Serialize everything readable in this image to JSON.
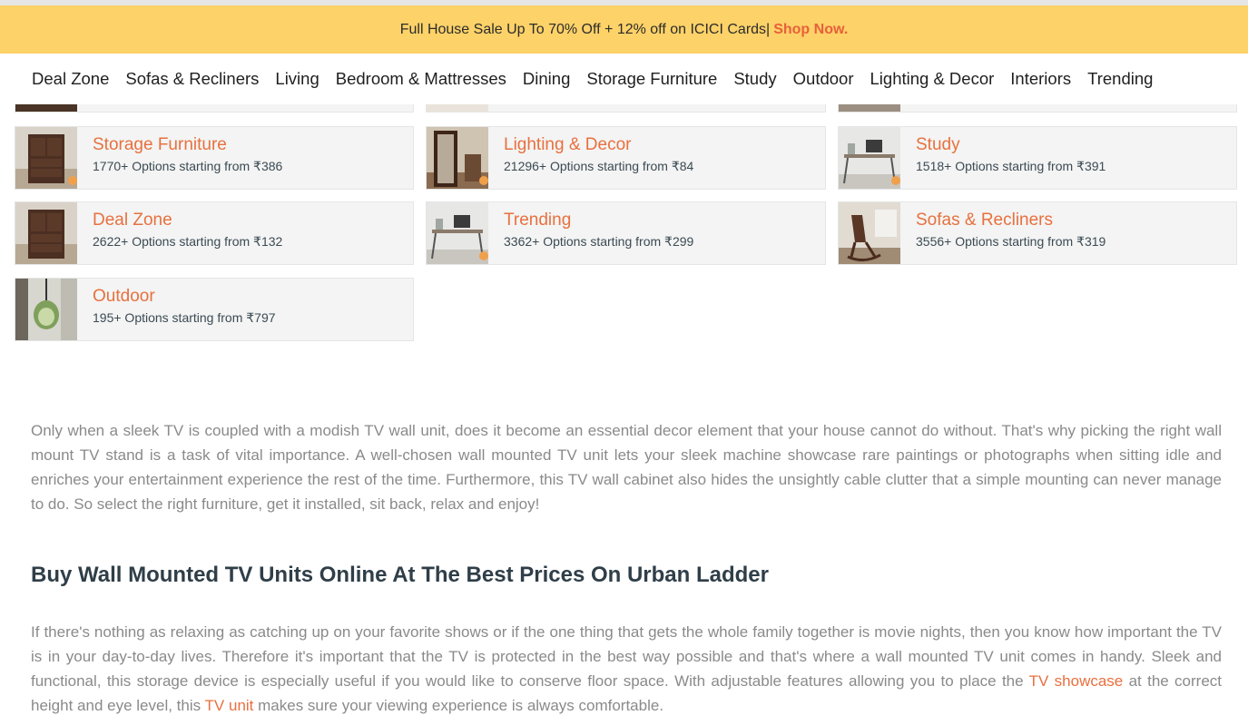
{
  "banner": {
    "text": "Full House Sale Up To 70% Off + 12% off on ICICI Cards|",
    "cta": "Shop Now."
  },
  "nav": {
    "items": [
      "Deal Zone",
      "Sofas & Recliners",
      "Living",
      "Bedroom & Mattresses",
      "Dining",
      "Storage Furniture",
      "Study",
      "Outdoor",
      "Lighting & Decor",
      "Interiors",
      "Trending"
    ]
  },
  "categories": [
    {
      "title": "Storage Furniture",
      "count": "1770+ Options starting from ",
      "price": "₹386",
      "thumb": "wooden-cabinet-icon"
    },
    {
      "title": "Lighting & Decor",
      "count": "21296+ Options starting from ",
      "price": "₹84",
      "thumb": "floor-mirror-icon"
    },
    {
      "title": "Study",
      "count": "1518+ Options starting from ",
      "price": "₹391",
      "thumb": "study-desk-icon"
    },
    {
      "title": "Deal Zone",
      "count": "2622+ Options starting from ",
      "price": "₹132",
      "thumb": "wooden-cabinet-icon"
    },
    {
      "title": "Trending",
      "count": "3362+ Options starting from ",
      "price": "₹299",
      "thumb": "study-desk-icon"
    },
    {
      "title": "Sofas & Recliners",
      "count": "3556+ Options starting from ",
      "price": "₹319",
      "thumb": "rocking-chair-icon"
    },
    {
      "title": "Outdoor",
      "count": "195+ Options starting from ",
      "price": "₹797",
      "thumb": "hanging-swing-icon"
    }
  ],
  "content": {
    "intro": "Only when a sleek TV is coupled with a modish TV wall unit, does it become an essential decor element that your house cannot do without. That's why picking the right wall mount TV stand is a task of vital importance. A well-chosen wall mounted TV unit lets your sleek machine showcase rare paintings or photographs when sitting idle and enriches your entertainment experience the rest of the time. Furthermore, this TV wall cabinet also hides the unsightly cable clutter that a simple mounting can never manage to do. So select the right furniture, get it installed, sit back, relax and enjoy!",
    "heading": "Buy Wall Mounted TV Units Online At The Best Prices On Urban Ladder",
    "body_part1": "If there's nothing as relaxing as catching up on your favorite shows or if the one thing that gets the whole family together is movie nights, then you know how important the TV is in your day-to-day lives. Therefore it's important that the TV is protected in the best way possible and that's where a wall mounted TV unit comes in handy. Sleek and functional, this storage device is especially useful if you would like to conserve floor space. With adjustable features allowing you to place the ",
    "link1": "TV showcase",
    "body_part2": " at the correct height and eye level, this ",
    "link2": "TV unit",
    "body_part3": " makes sure your viewing experience is always comfortable."
  }
}
